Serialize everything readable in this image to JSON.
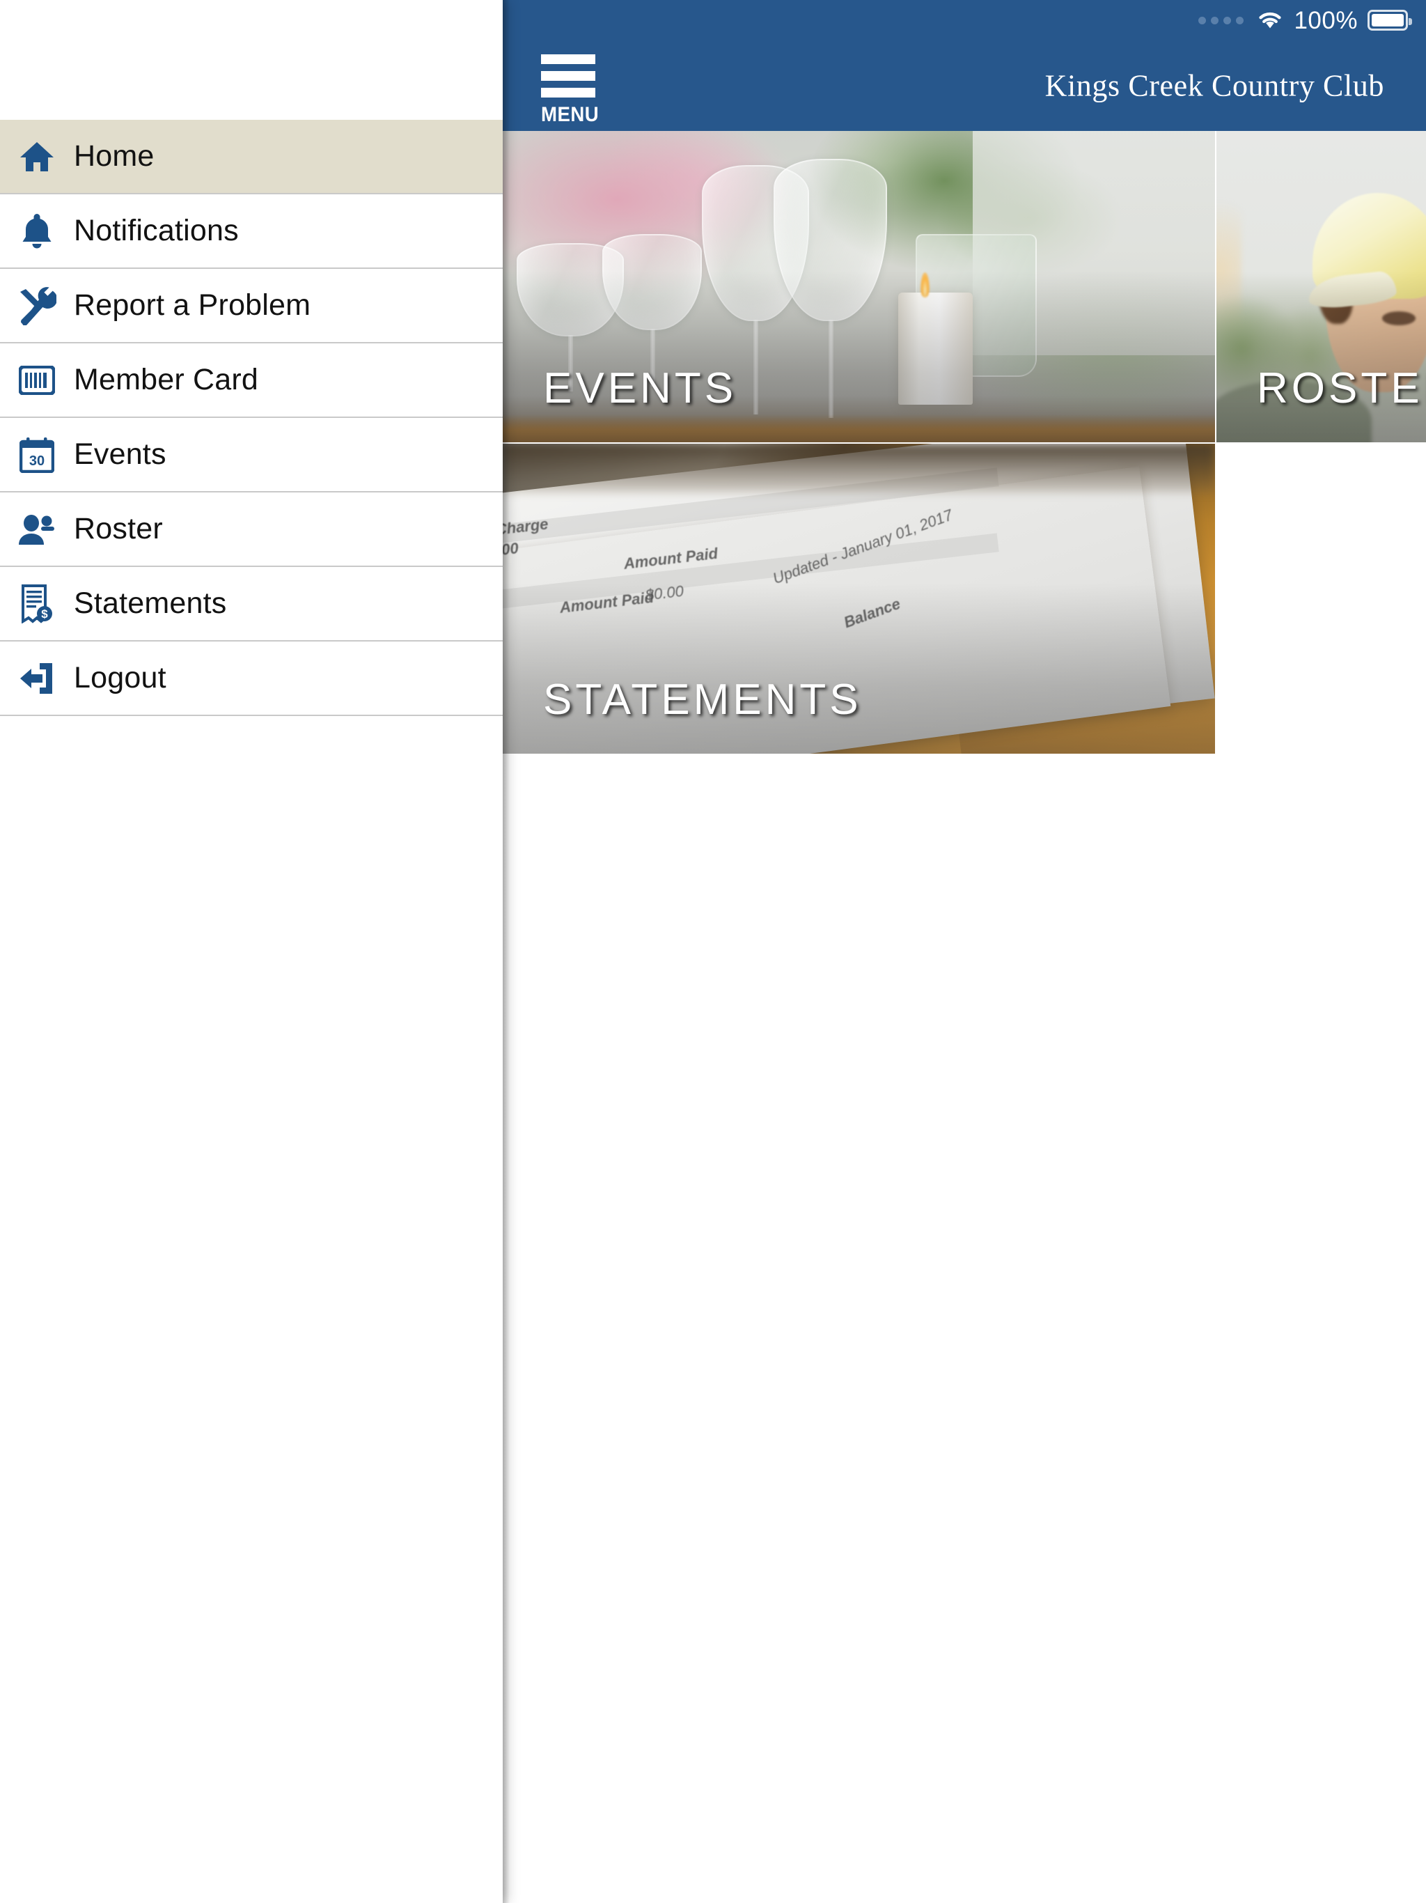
{
  "colors": {
    "header_blue": "#27578c",
    "active_row": "#e1ddcc",
    "icon_blue": "#1d5288",
    "divider": "#c9c9c9",
    "page_bg": "#ffffff"
  },
  "status_bar": {
    "signal_dots": 4,
    "wifi_icon": "wifi-icon",
    "battery_percent": "100%",
    "battery_icon": "battery-full-icon"
  },
  "header": {
    "menu_button": {
      "icon": "hamburger-menu-icon",
      "label": "MENU"
    },
    "title": "Kings Creek Country Club"
  },
  "drawer": {
    "items": [
      {
        "label": "Home",
        "icon": "home-icon",
        "active": true
      },
      {
        "label": "Notifications",
        "icon": "bell-icon",
        "active": false
      },
      {
        "label": "Report a Problem",
        "icon": "tools-icon",
        "active": false
      },
      {
        "label": "Member Card",
        "icon": "barcode-card-icon",
        "active": false
      },
      {
        "label": "Events",
        "icon": "calendar-30-icon",
        "active": false
      },
      {
        "label": "Roster",
        "icon": "people-icon",
        "active": false
      },
      {
        "label": "Statements",
        "icon": "invoice-dollar-icon",
        "active": false
      },
      {
        "label": "Logout",
        "icon": "logout-arrow-icon",
        "active": false
      }
    ]
  },
  "tiles": [
    {
      "id": "events",
      "label": "EVENTS",
      "photo": "table-setting-wine-glasses-candle-flowers"
    },
    {
      "id": "roster",
      "label": "ROSTER",
      "photo": "woman-in-yellow-cap-outdoors"
    },
    {
      "id": "statements",
      "label": "STATEMENTS",
      "photo": "printed-account-statement-on-desk"
    }
  ],
  "statement_photo_text": {
    "charge": "Charge",
    "amount_paid_1": "Amount Paid",
    "amount_value": "$0.00",
    "amount_paid_2": "Amount Paid",
    "updated": "Updated - January 01, 2017",
    "balance": "Balance"
  }
}
